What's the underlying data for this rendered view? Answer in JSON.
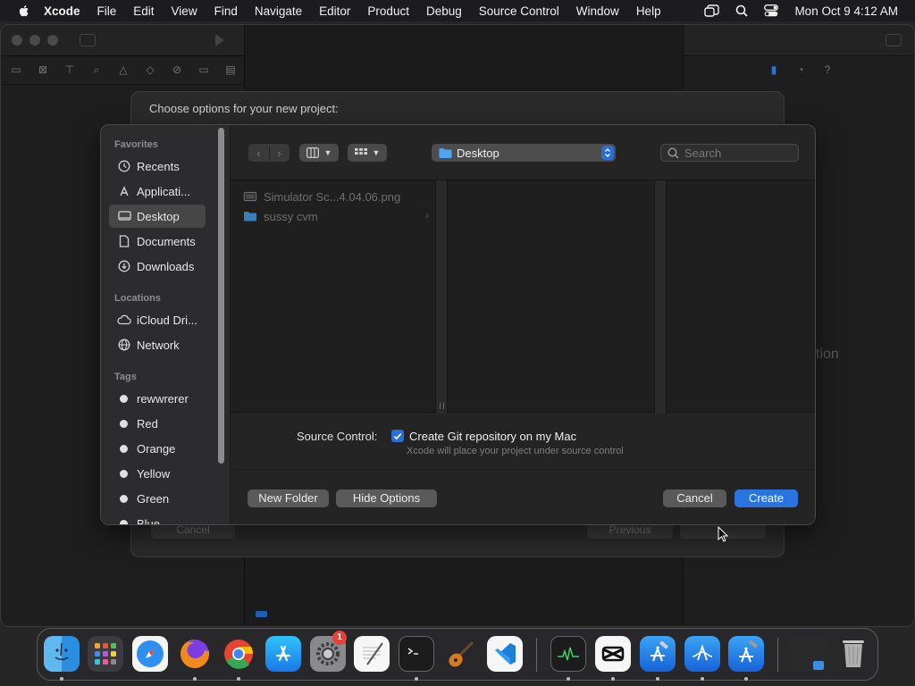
{
  "menubar": {
    "app_name": "Xcode",
    "items": [
      "File",
      "Edit",
      "View",
      "Find",
      "Navigate",
      "Editor",
      "Product",
      "Debug",
      "Source Control",
      "Window",
      "Help"
    ],
    "clock": "Mon Oct 9  4:12 AM"
  },
  "background_window": {
    "sheet_title": "Choose options for your new project:",
    "sheet_cancel": "Cancel",
    "sheet_previous": "Previous",
    "partial_text": "tion"
  },
  "save_panel": {
    "sidebar": {
      "favorites_header": "Favorites",
      "favorites": [
        {
          "label": "Recents",
          "icon": "clock-icon"
        },
        {
          "label": "Applicati...",
          "icon": "applications-icon"
        },
        {
          "label": "Desktop",
          "icon": "desktop-icon",
          "selected": true
        },
        {
          "label": "Documents",
          "icon": "document-icon"
        },
        {
          "label": "Downloads",
          "icon": "download-icon"
        }
      ],
      "locations_header": "Locations",
      "locations": [
        {
          "label": "iCloud Dri...",
          "icon": "cloud-icon"
        },
        {
          "label": "Network",
          "icon": "globe-icon"
        }
      ],
      "tags_header": "Tags",
      "tags": [
        "rewwrerer",
        "Red",
        "Orange",
        "Yellow",
        "Green",
        "Blue"
      ]
    },
    "toolbar": {
      "location": "Desktop",
      "search_placeholder": "Search"
    },
    "files": [
      {
        "name": "Simulator Sc...4.04.06.png",
        "kind": "image"
      },
      {
        "name": "sussy cvm",
        "kind": "folder"
      }
    ],
    "source_control_label": "Source Control:",
    "git_checkbox_label": "Create Git repository on my Mac",
    "git_checkbox_checked": true,
    "git_checkbox_hint": "Xcode will place your project under source control",
    "new_folder_label": "New Folder",
    "hide_options_label": "Hide Options",
    "cancel_label": "Cancel",
    "create_label": "Create"
  },
  "dock": {
    "apps": [
      "Finder",
      "Launchpad",
      "Safari",
      "Firefox",
      "Chrome",
      "App Store",
      "System Settings",
      "TextEdit",
      "Terminal",
      "Instruments",
      "Visual Studio Code",
      "Activity Monitor",
      "CapCut",
      "Xcode Build",
      "Simulator",
      "Xcode"
    ],
    "settings_badge": "1"
  },
  "colors": {
    "accent": "#2a74e0",
    "panel_bg": "#262626",
    "sidebar_bg": "#2c2c2e"
  }
}
